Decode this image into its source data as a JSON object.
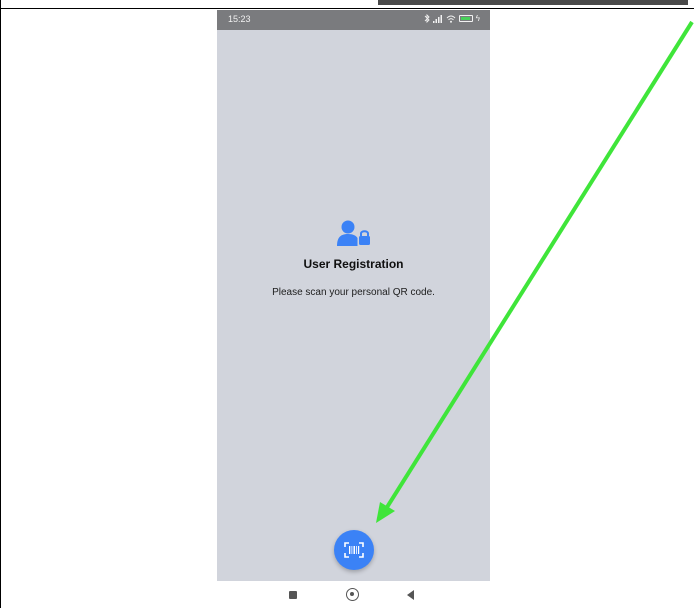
{
  "status_bar": {
    "time": "15:23",
    "icons": [
      "bluetooth-icon",
      "signal-icon",
      "wifi-icon",
      "battery-icon"
    ]
  },
  "main": {
    "icon": "user-lock-icon",
    "title": "User Registration",
    "subtitle": "Please scan your personal QR code."
  },
  "fab": {
    "icon": "barcode-scan-icon"
  },
  "nav_bar": {
    "items": [
      "recents-button",
      "home-button",
      "back-button"
    ]
  },
  "colors": {
    "accent": "#3b82f6",
    "screen_bg": "#d1d4dc",
    "annotation_arrow": "#3fe53a"
  }
}
